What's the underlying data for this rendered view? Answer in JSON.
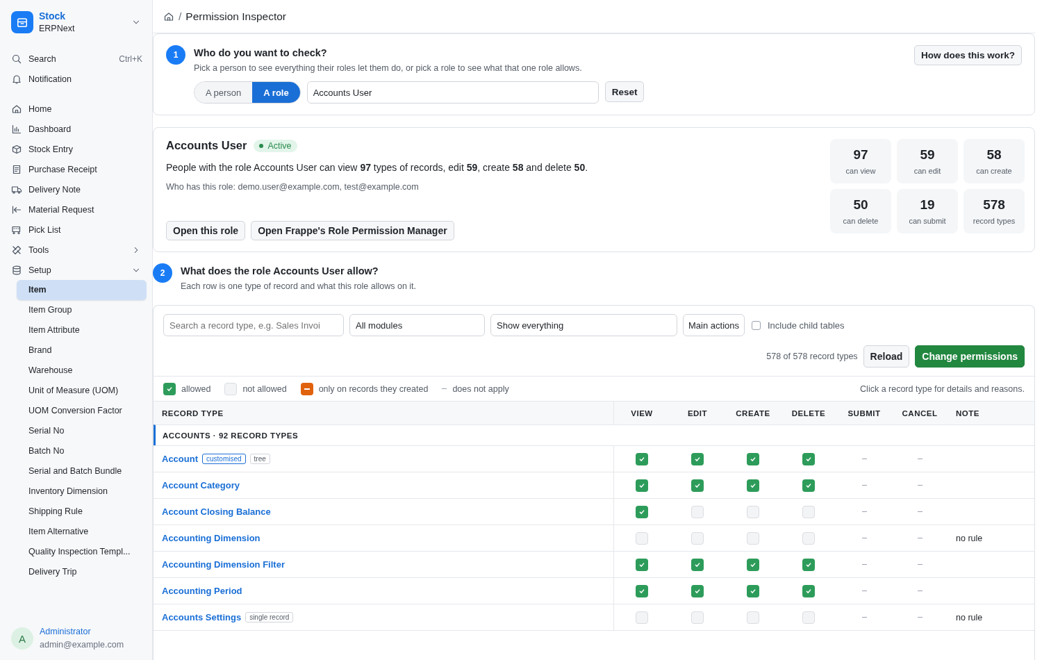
{
  "app": {
    "name": "Stock",
    "subtitle": "ERPNext"
  },
  "sidebar": {
    "quick": [
      {
        "label": "Search",
        "shortcut": "Ctrl+K"
      },
      {
        "label": "Notification"
      }
    ],
    "items": [
      {
        "label": "Home"
      },
      {
        "label": "Dashboard"
      },
      {
        "label": "Stock Entry"
      },
      {
        "label": "Purchase Receipt"
      },
      {
        "label": "Delivery Note"
      },
      {
        "label": "Material Request"
      },
      {
        "label": "Pick List"
      },
      {
        "label": "Tools",
        "expanded": false
      },
      {
        "label": "Setup",
        "expanded": true,
        "children": [
          {
            "label": "Item",
            "selected": true
          },
          {
            "label": "Item Group",
            "selected": false
          },
          {
            "label": "Item Attribute",
            "selected": false
          },
          {
            "label": "Brand",
            "selected": false
          },
          {
            "label": "Warehouse",
            "selected": false
          },
          {
            "label": "Unit of Measure (UOM)",
            "selected": false
          },
          {
            "label": "UOM Conversion Factor",
            "selected": false
          },
          {
            "label": "Serial No",
            "selected": false
          },
          {
            "label": "Batch No",
            "selected": false
          },
          {
            "label": "Serial and Batch Bundle",
            "selected": false
          },
          {
            "label": "Inventory Dimension",
            "selected": false
          },
          {
            "label": "Shipping Rule",
            "selected": false
          },
          {
            "label": "Item Alternative",
            "selected": false
          },
          {
            "label": "Quality Inspection Templ...",
            "selected": false
          },
          {
            "label": "Delivery Trip",
            "selected": false
          }
        ]
      }
    ],
    "user": {
      "initial": "A",
      "name": "Administrator",
      "email": "admin@example.com"
    }
  },
  "breadcrumb": {
    "separator": "/",
    "title": "Permission Inspector"
  },
  "step1": {
    "number": "1",
    "title": "Who do you want to check?",
    "hint": "Pick a person to see everything their roles let them do, or pick a role to see what that one role allows.",
    "help_button": "How does this work?",
    "modes": [
      {
        "label": "A person",
        "selected": false
      },
      {
        "label": "A role",
        "selected": true
      }
    ],
    "role_field": {
      "value": "Accounts User"
    },
    "reset_button": "Reset"
  },
  "role": {
    "name": "Accounts User",
    "status": "Active",
    "description": "People with the role Accounts User can view **97** types of records, edit **59**, create **58** and delete **50**.",
    "holders": "Who has this role: demo.user@example.com, test@example.com",
    "buttons": [
      "Open this role",
      "Open Frappe's Role Permission Manager"
    ],
    "stats": [
      {
        "value": "97",
        "label": "can view"
      },
      {
        "value": "59",
        "label": "can edit"
      },
      {
        "value": "58",
        "label": "can create"
      },
      {
        "value": "50",
        "label": "can delete"
      },
      {
        "value": "19",
        "label": "can submit"
      },
      {
        "value": "578",
        "label": "record types"
      }
    ]
  },
  "step2": {
    "number": "2",
    "title": "What does the role Accounts User allow?",
    "hint": "Each row is one type of record and what this role allows on it."
  },
  "filters": {
    "search_placeholder": "Search a record type, e.g. Sales Invoi",
    "module": "All modules",
    "show": "Show everything",
    "actions": "Main actions",
    "include_child": {
      "label": "Include child tables",
      "checked": false
    },
    "count": "578 of 578 record types",
    "reload_button": "Reload",
    "change_button": "Change permissions"
  },
  "legend": {
    "items": [
      {
        "kind": "allowed",
        "label": "allowed"
      },
      {
        "kind": "denied",
        "label": "not allowed"
      },
      {
        "kind": "owner",
        "label": "only on records they created"
      },
      {
        "kind": "na",
        "label": "does not apply"
      }
    ],
    "hint": "Click a record type for details and reasons."
  },
  "table": {
    "columns": [
      "RECORD TYPE",
      "VIEW",
      "EDIT",
      "CREATE",
      "DELETE",
      "SUBMIT",
      "CANCEL",
      "NOTE"
    ],
    "group": "ACCOUNTS · 92 RECORD TYPES",
    "rows": [
      {
        "name": "Account",
        "tags": [
          {
            "label": "customised",
            "kind": "customised"
          },
          {
            "label": "tree",
            "kind": "plain"
          }
        ],
        "cells": [
          {
            "applies": true,
            "allowed": true
          },
          {
            "applies": true,
            "allowed": true
          },
          {
            "applies": true,
            "allowed": true
          },
          {
            "applies": true,
            "allowed": true
          },
          {
            "applies": false
          },
          {
            "applies": false
          }
        ]
      },
      {
        "name": "Account Category",
        "cells": [
          {
            "applies": true,
            "allowed": true
          },
          {
            "applies": true,
            "allowed": true
          },
          {
            "applies": true,
            "allowed": true
          },
          {
            "applies": true,
            "allowed": true
          },
          {
            "applies": false
          },
          {
            "applies": false
          }
        ]
      },
      {
        "name": "Account Closing Balance",
        "cells": [
          {
            "applies": true,
            "allowed": true
          },
          {
            "applies": true,
            "allowed": false
          },
          {
            "applies": true,
            "allowed": false
          },
          {
            "applies": true,
            "allowed": false
          },
          {
            "applies": false
          },
          {
            "applies": false
          }
        ]
      },
      {
        "name": "Accounting Dimension",
        "cells": [
          {
            "applies": true,
            "allowed": false
          },
          {
            "applies": true,
            "allowed": false
          },
          {
            "applies": true,
            "allowed": false
          },
          {
            "applies": true,
            "allowed": false
          },
          {
            "applies": false
          },
          {
            "applies": false
          }
        ],
        "note": "no rule"
      },
      {
        "name": "Accounting Dimension Filter",
        "cells": [
          {
            "applies": true,
            "allowed": true
          },
          {
            "applies": true,
            "allowed": true
          },
          {
            "applies": true,
            "allowed": true
          },
          {
            "applies": true,
            "allowed": true
          },
          {
            "applies": false
          },
          {
            "applies": false
          }
        ]
      },
      {
        "name": "Accounting Period",
        "cells": [
          {
            "applies": true,
            "allowed": true
          },
          {
            "applies": true,
            "allowed": true
          },
          {
            "applies": true,
            "allowed": true
          },
          {
            "applies": true,
            "allowed": true
          },
          {
            "applies": false
          },
          {
            "applies": false
          }
        ]
      },
      {
        "name": "Accounts Settings",
        "tags": [
          {
            "label": "single record",
            "kind": "plain"
          }
        ],
        "cells": [
          {
            "applies": true,
            "allowed": false
          },
          {
            "applies": true,
            "allowed": false
          },
          {
            "applies": true,
            "allowed": false
          },
          {
            "applies": true,
            "allowed": false
          },
          {
            "applies": false
          },
          {
            "applies": false
          }
        ],
        "note": "no rule"
      }
    ]
  }
}
